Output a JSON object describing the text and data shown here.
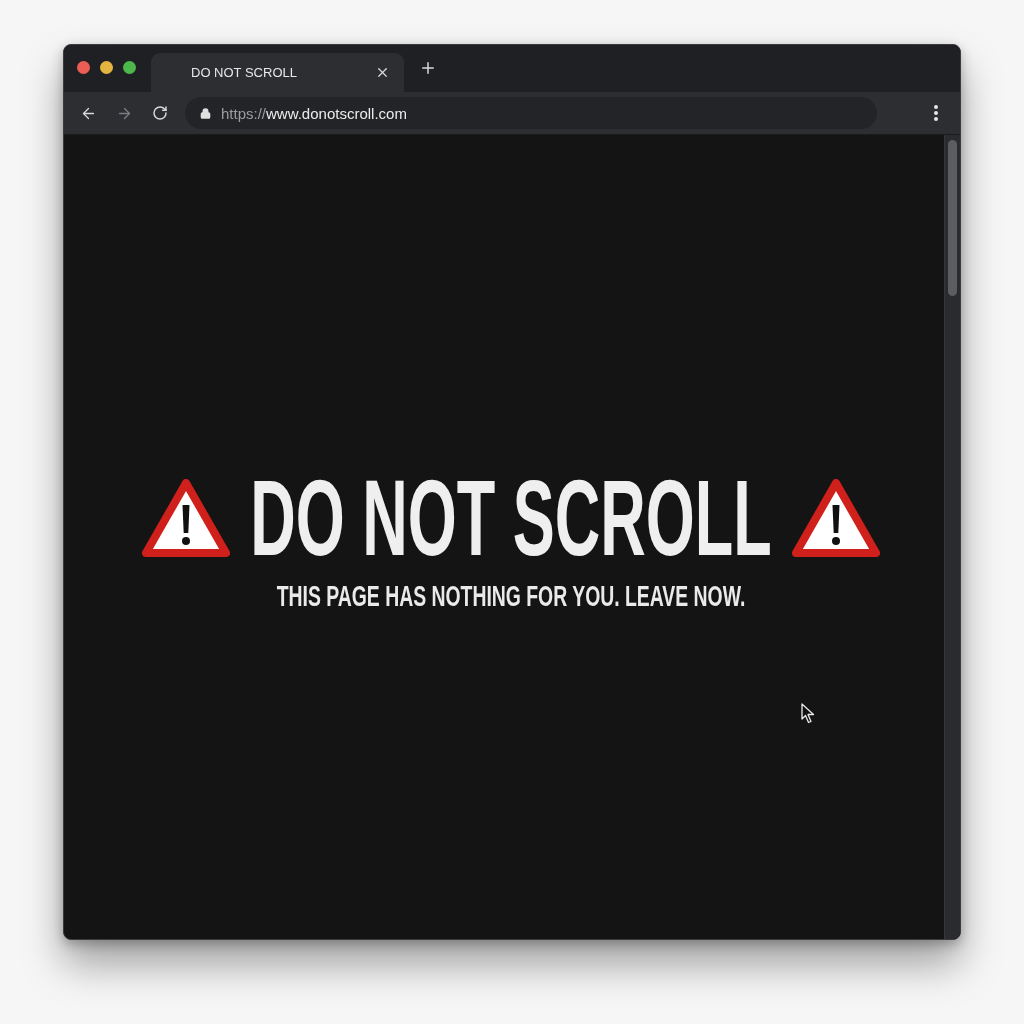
{
  "window_controls": [
    {
      "color": "#ec5e55"
    },
    {
      "color": "#e4b440"
    },
    {
      "color": "#4cb74a"
    }
  ],
  "tabs": [
    {
      "title": "DO NOT SCROLL",
      "selected": true
    }
  ],
  "toolbar": {
    "back": {
      "disabled": false
    },
    "forward": {
      "disabled": true
    }
  },
  "address_bar": {
    "scheme": "https://",
    "host": "www.donotscroll.com"
  },
  "page": {
    "heading": "DO NOT SCROLL",
    "subheading": "THIS PAGE HAS NOTHING FOR YOU. LEAVE NOW."
  }
}
